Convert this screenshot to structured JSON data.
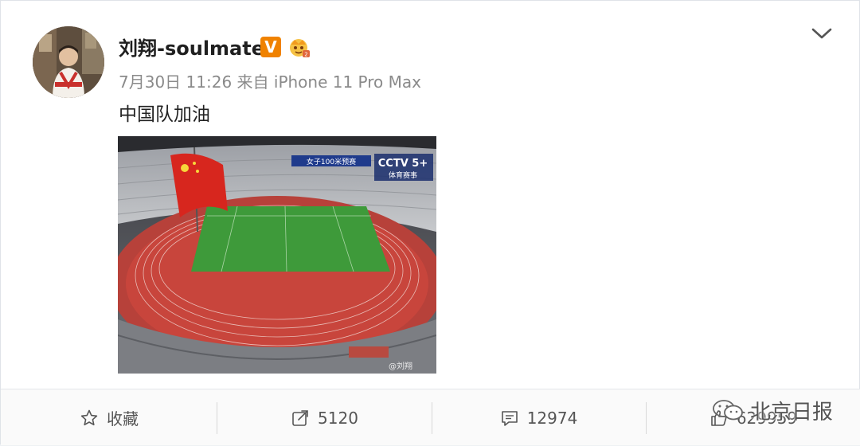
{
  "post": {
    "author": "刘翔-soulmate",
    "verified_badge": "V",
    "timestamp": "7月30日 11:26",
    "source": "来自 iPhone 11 Pro Max",
    "text": "中国队加油"
  },
  "photo": {
    "scoreboard_text": "女子100米预赛",
    "broadcaster": "CCTV 5+",
    "broadcaster_sub": "体育赛事",
    "image_watermark": "@刘翔"
  },
  "actions": {
    "favorite_label": "收藏",
    "repost_count": "5120",
    "comment_count": "12974",
    "like_count": "629959"
  },
  "watermark": {
    "text": "北京日报"
  },
  "colors": {
    "badge_orange": "#f08200",
    "track_red": "#c8453c",
    "field_green": "#3e9a3a"
  },
  "icons": {
    "menu": "chevron-down-icon",
    "favorite": "star-icon",
    "repost": "share-icon",
    "comment": "comment-icon",
    "like": "thumbs-up-icon"
  }
}
